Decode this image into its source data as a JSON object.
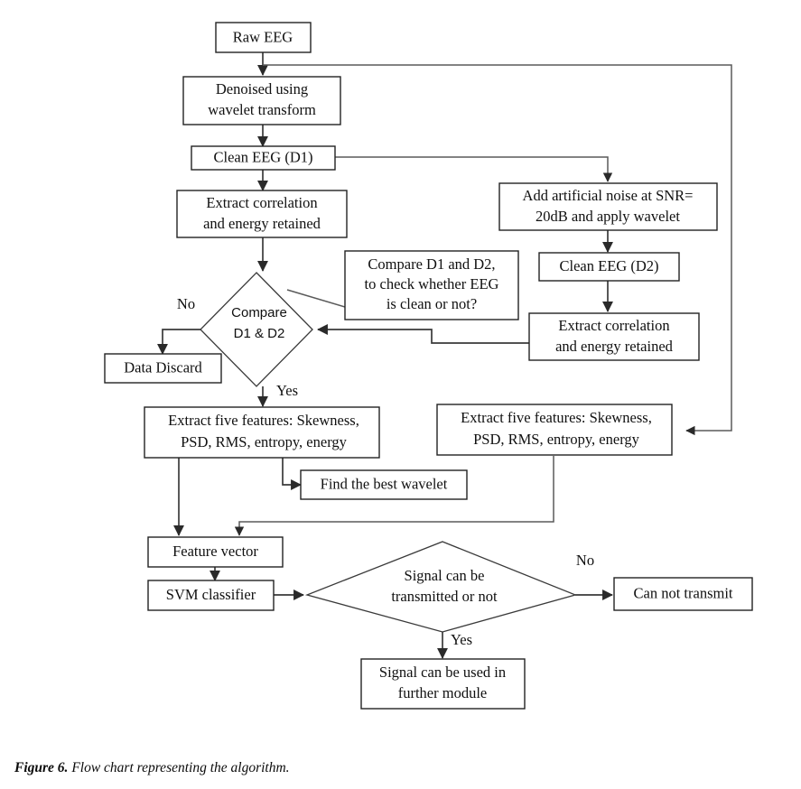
{
  "figure": {
    "caption_lead": "Figure 6.",
    "caption_text": " Flow chart representing the algorithm."
  },
  "colors": {
    "box_stroke": "#222222",
    "diamond_stroke": "#3a3a3a",
    "connector": "#3a3a3a",
    "text": "#101010",
    "background": "#ffffff"
  },
  "nodes": {
    "raw_eeg": {
      "label": "Raw EEG",
      "shape": "rect"
    },
    "denoised": {
      "line1": "Denoised using",
      "line2": "wavelet transform",
      "shape": "rect"
    },
    "clean_d1": {
      "label": "Clean EEG (D1)",
      "shape": "rect"
    },
    "extract_corr_left": {
      "line1": "Extract correlation",
      "line2": "and energy retained",
      "shape": "rect"
    },
    "add_noise": {
      "line1": "Add artificial noise at SNR=",
      "line2": "20dB and apply wavelet",
      "shape": "rect"
    },
    "clean_d2": {
      "label": "Clean EEG (D2)",
      "shape": "rect"
    },
    "extract_corr_right": {
      "line1": "Extract correlation",
      "line2": "and energy retained",
      "shape": "rect"
    },
    "compare_note": {
      "line1": "Compare D1 and D2,",
      "line2": "to check whether EEG",
      "line3": "is clean or not?",
      "shape": "rect"
    },
    "compare_decision": {
      "line1": "Compare",
      "line2": "D1 & D2",
      "shape": "diamond"
    },
    "data_discard": {
      "label": "Data Discard",
      "shape": "rect"
    },
    "extract_five_left": {
      "line1": "Extract five features:  Skewness,",
      "line2": "PSD, RMS, entropy, energy",
      "shape": "rect"
    },
    "extract_five_right": {
      "line1": "Extract five features:  Skewness,",
      "line2": "PSD, RMS, entropy, energy",
      "shape": "rect"
    },
    "best_wavelet": {
      "label": "Find the best wavelet",
      "shape": "rect"
    },
    "feature_vector": {
      "label": "Feature vector",
      "shape": "rect"
    },
    "svm_classifier": {
      "label": "SVM classifier",
      "shape": "rect"
    },
    "transmit_decision": {
      "line1": "Signal can be",
      "line2": "transmitted or not",
      "shape": "diamond"
    },
    "cannot_transmit": {
      "label": "Can not transmit",
      "shape": "rect"
    },
    "signal_used": {
      "line1": "Signal can be used in",
      "line2": "further module",
      "shape": "rect"
    }
  },
  "edge_labels": {
    "compare_no": "No",
    "compare_yes": "Yes",
    "transmit_no": "No",
    "transmit_yes": "Yes"
  }
}
